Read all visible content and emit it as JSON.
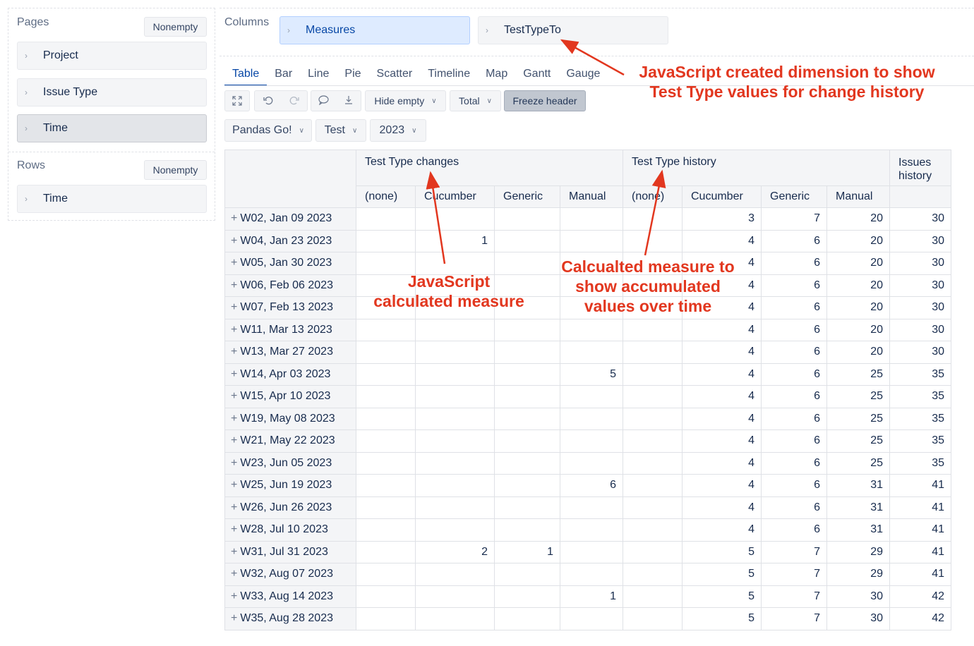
{
  "pages": {
    "label": "Pages",
    "nonempty_label": "Nonempty",
    "items": [
      {
        "label": "Project"
      },
      {
        "label": "Issue Type"
      },
      {
        "label": "Time"
      }
    ]
  },
  "rows": {
    "label": "Rows",
    "nonempty_label": "Nonempty",
    "items": [
      {
        "label": "Time"
      }
    ]
  },
  "columns": {
    "label": "Columns",
    "items": [
      {
        "label": "Measures"
      },
      {
        "label": "TestTypeTo"
      }
    ]
  },
  "tabs": [
    "Table",
    "Bar",
    "Line",
    "Pie",
    "Scatter",
    "Timeline",
    "Map",
    "Gantt",
    "Gauge"
  ],
  "active_tab": "Table",
  "toolbar": {
    "icons": [
      "fullscreen-icon",
      "undo-icon",
      "redo-icon",
      "comment-icon",
      "export-icon"
    ],
    "hide_empty_label": "Hide empty",
    "total_label": "Total",
    "freeze_header_label": "Freeze header"
  },
  "page_filters": [
    {
      "label": "Pandas Go!"
    },
    {
      "label": "Test"
    },
    {
      "label": "2023"
    }
  ],
  "table": {
    "groups": [
      {
        "label": "Test Type changes"
      },
      {
        "label": "Test Type history"
      },
      {
        "label": "Issues history"
      }
    ],
    "subheaders": [
      "(none)",
      "Cucumber",
      "Generic",
      "Manual",
      "(none)",
      "Cucumber",
      "Generic",
      "Manual"
    ],
    "rows": [
      {
        "label": "W02, Jan 09 2023",
        "values": [
          "",
          "",
          "",
          "",
          "",
          "3",
          "7",
          "20",
          "30"
        ]
      },
      {
        "label": "W04, Jan 23 2023",
        "values": [
          "",
          "1",
          "",
          "",
          "",
          "4",
          "6",
          "20",
          "30"
        ]
      },
      {
        "label": "W05, Jan 30 2023",
        "values": [
          "",
          "",
          "",
          "",
          "",
          "4",
          "6",
          "20",
          "30"
        ]
      },
      {
        "label": "W06, Feb 06 2023",
        "values": [
          "",
          "",
          "",
          "",
          "",
          "4",
          "6",
          "20",
          "30"
        ]
      },
      {
        "label": "W07, Feb 13 2023",
        "values": [
          "",
          "",
          "",
          "",
          "",
          "4",
          "6",
          "20",
          "30"
        ]
      },
      {
        "label": "W11, Mar 13 2023",
        "values": [
          "",
          "",
          "",
          "",
          "",
          "4",
          "6",
          "20",
          "30"
        ]
      },
      {
        "label": "W13, Mar 27 2023",
        "values": [
          "",
          "",
          "",
          "",
          "",
          "4",
          "6",
          "20",
          "30"
        ]
      },
      {
        "label": "W14, Apr 03 2023",
        "values": [
          "",
          "",
          "",
          "5",
          "",
          "4",
          "6",
          "25",
          "35"
        ]
      },
      {
        "label": "W15, Apr 10 2023",
        "values": [
          "",
          "",
          "",
          "",
          "",
          "4",
          "6",
          "25",
          "35"
        ]
      },
      {
        "label": "W19, May 08 2023",
        "values": [
          "",
          "",
          "",
          "",
          "",
          "4",
          "6",
          "25",
          "35"
        ]
      },
      {
        "label": "W21, May 22 2023",
        "values": [
          "",
          "",
          "",
          "",
          "",
          "4",
          "6",
          "25",
          "35"
        ]
      },
      {
        "label": "W23, Jun 05 2023",
        "values": [
          "",
          "",
          "",
          "",
          "",
          "4",
          "6",
          "25",
          "35"
        ]
      },
      {
        "label": "W25, Jun 19 2023",
        "values": [
          "",
          "",
          "",
          "6",
          "",
          "4",
          "6",
          "31",
          "41"
        ]
      },
      {
        "label": "W26, Jun 26 2023",
        "values": [
          "",
          "",
          "",
          "",
          "",
          "4",
          "6",
          "31",
          "41"
        ]
      },
      {
        "label": "W28, Jul 10 2023",
        "values": [
          "",
          "",
          "",
          "",
          "",
          "4",
          "6",
          "31",
          "41"
        ]
      },
      {
        "label": "W31, Jul 31 2023",
        "values": [
          "",
          "2",
          "1",
          "",
          "",
          "5",
          "7",
          "29",
          "41"
        ]
      },
      {
        "label": "W32, Aug 07 2023",
        "values": [
          "",
          "",
          "",
          "",
          "",
          "5",
          "7",
          "29",
          "41"
        ]
      },
      {
        "label": "W33, Aug 14 2023",
        "values": [
          "",
          "",
          "",
          "1",
          "",
          "5",
          "7",
          "30",
          "42"
        ]
      },
      {
        "label": "W35, Aug 28 2023",
        "values": [
          "",
          "",
          "",
          "",
          "",
          "5",
          "7",
          "30",
          "42"
        ]
      }
    ]
  },
  "annotations": {
    "dimension": "JavaScript created dimension to show Test Type values for change history",
    "calculated": "JavaScript calculated measure",
    "accumulated": "Calcualted measure to show accumulated values over time",
    "color": "#e2371f"
  }
}
